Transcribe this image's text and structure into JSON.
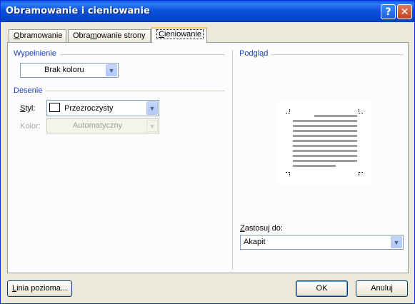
{
  "window": {
    "title": "Obramowanie i cieniowanie",
    "help_label": "?",
    "close_label": "✕"
  },
  "tabs": [
    {
      "pre": "",
      "acc": "O",
      "post": "bramowanie"
    },
    {
      "pre": "Obra",
      "acc": "m",
      "post": "owanie strony"
    },
    {
      "pre": "",
      "acc": "C",
      "post": "ieniowanie"
    }
  ],
  "fill": {
    "section_label": "Wypełnienie",
    "color_value": "Brak koloru"
  },
  "patterns": {
    "section_label": "Desenie",
    "style_label_acc": "S",
    "style_label_rest": "tyl:",
    "style_value": "Przezroczysty",
    "color_label": "Kolor:",
    "color_value": "Automatyczny"
  },
  "preview": {
    "section_label": "Podgląd",
    "apply_label_acc": "Z",
    "apply_label_rest": "astosuj do:",
    "apply_value": "Akapit"
  },
  "buttons": {
    "horizontal_line_acc": "L",
    "horizontal_line_rest": "inia pozioma...",
    "ok": "OK",
    "cancel": "Anuluj"
  },
  "icons": {
    "dropdown_arrow": "chevron-down-icon",
    "swatch": "color-swatch-icon"
  }
}
